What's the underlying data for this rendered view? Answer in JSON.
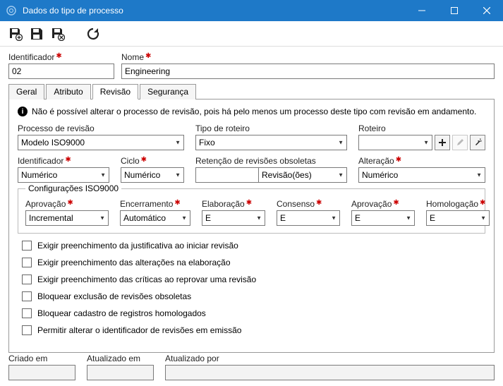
{
  "window": {
    "title": "Dados do tipo de processo"
  },
  "header": {
    "identificador_label": "Identificador",
    "identificador_value": "02",
    "nome_label": "Nome",
    "nome_value": "Engineering"
  },
  "tabs": {
    "geral": "Geral",
    "atributo": "Atributo",
    "revisao": "Revisão",
    "seguranca": "Segurança"
  },
  "info": "Não é possível alterar o processo de revisão, pois há pelo menos um processo deste tipo com revisão em andamento.",
  "fields": {
    "processo_label": "Processo de revisão",
    "processo_value": "Modelo ISO9000",
    "tipo_roteiro_label": "Tipo de roteiro",
    "tipo_roteiro_value": "Fixo",
    "roteiro_label": "Roteiro",
    "roteiro_value": "",
    "identificador_label": "Identificador",
    "identificador_value": "Numérico",
    "ciclo_label": "Ciclo",
    "ciclo_value": "Numérico",
    "retencao_label": "Retenção de revisões obsoletas",
    "retencao_value": "",
    "retencao_unit": "Revisão(ões)",
    "alteracao_label": "Alteração",
    "alteracao_value": "Numérico"
  },
  "iso": {
    "legend": "Configurações ISO9000",
    "aprovacao1_label": "Aprovação",
    "aprovacao1_value": "Incremental",
    "encerramento_label": "Encerramento",
    "encerramento_value": "Automático",
    "elaboracao_label": "Elaboração",
    "elaboracao_value": "E",
    "consenso_label": "Consenso",
    "consenso_value": "E",
    "aprovacao2_label": "Aprovação",
    "aprovacao2_value": "E",
    "homologacao_label": "Homologação",
    "homologacao_value": "E"
  },
  "checks": {
    "c1": "Exigir preenchimento da justificativa ao iniciar revisão",
    "c2": "Exigir preenchimento das alterações na elaboração",
    "c3": "Exigir preenchimento das críticas ao reprovar uma revisão",
    "c4": "Bloquear exclusão de revisões obsoletas",
    "c5": "Bloquear cadastro de registros homologados",
    "c6": "Permitir alterar o identificador de revisões em emissão"
  },
  "footer": {
    "criado_label": "Criado em",
    "criado_value": "",
    "atualizado_em_label": "Atualizado em",
    "atualizado_em_value": "",
    "atualizado_por_label": "Atualizado por",
    "atualizado_por_value": ""
  }
}
